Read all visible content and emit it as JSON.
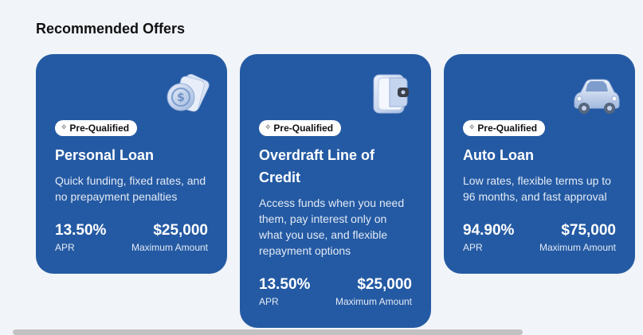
{
  "section": {
    "title": "Recommended Offers"
  },
  "offers": [
    {
      "badge": "Pre-Qualified",
      "title": "Personal Loan",
      "description": "Quick funding, fixed rates, and no prepayment penalties",
      "rate_value": "13.50%",
      "rate_label": "APR",
      "amount_value": "$25,000",
      "amount_label": "Maximum Amount",
      "icon": "coins-icon"
    },
    {
      "badge": "Pre-Qualified",
      "title": "Overdraft Line of Credit",
      "description": "Access funds when you need them, pay interest only on what you use, and flexible repayment options",
      "rate_value": "13.50%",
      "rate_label": "APR",
      "amount_value": "$25,000",
      "amount_label": "Maximum Amount",
      "icon": "wallet-icon"
    },
    {
      "badge": "Pre-Qualified",
      "title": "Auto Loan",
      "description": "Low rates, flexible terms up to 96 months, and fast approval",
      "rate_value": "94.90%",
      "rate_label": "APR",
      "amount_value": "$75,000",
      "amount_label": "Maximum Amount",
      "icon": "car-icon"
    }
  ],
  "colors": {
    "card": "#245aa3",
    "page": "#f1f4f9",
    "badge_bg": "#ffffff"
  }
}
